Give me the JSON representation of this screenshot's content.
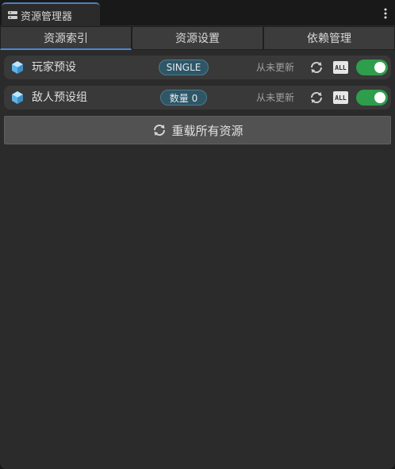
{
  "window": {
    "title": "资源管理器",
    "title_icon": "database-icon",
    "menu_icon": "more-vertical-icon"
  },
  "tabs": [
    {
      "label": "资源索引",
      "active": true
    },
    {
      "label": "资源设置",
      "active": false
    },
    {
      "label": "依赖管理",
      "active": false
    }
  ],
  "assets": [
    {
      "name": "玩家预设",
      "icon": "cube-icon",
      "badge": "SINGLE",
      "status": "从未更新",
      "all_label": "ALL",
      "enabled": true
    },
    {
      "name": "敌人预设组",
      "icon": "cube-icon",
      "badge": "数量 0",
      "status": "从未更新",
      "all_label": "ALL",
      "enabled": true
    }
  ],
  "reload_button": {
    "label": "重载所有资源",
    "icon": "refresh-icon"
  },
  "colors": {
    "accent": "#4a88d6",
    "toggle_on": "#2e9e4c",
    "badge_bg": "#2f5666",
    "panel_bg": "#2b2b2b"
  }
}
